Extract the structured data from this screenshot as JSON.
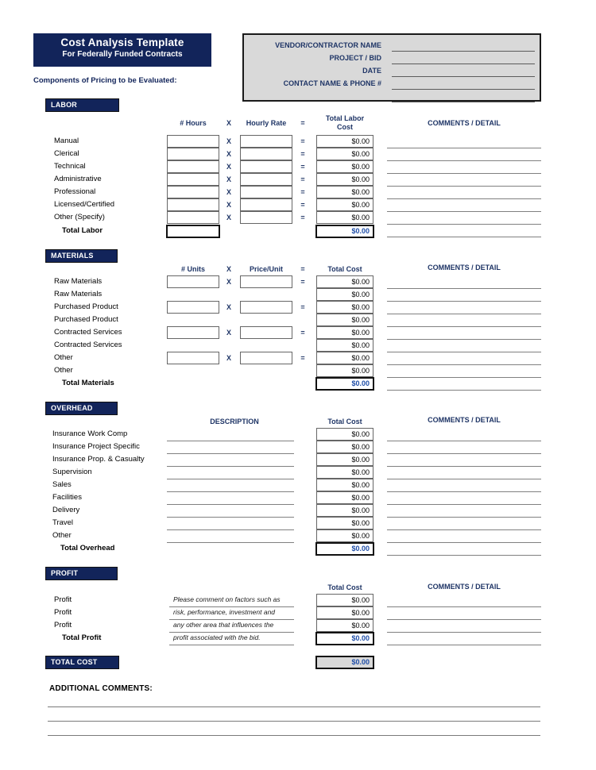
{
  "title": {
    "main": "Cost Analysis Template",
    "sub": "For Federally Funded Contracts",
    "components_label": "Components of Pricing to be Evaluated:"
  },
  "vendor_header": {
    "fields": [
      {
        "label": "VENDOR/CONTRACTOR NAME",
        "value": ""
      },
      {
        "label": "PROJECT / BID",
        "value": ""
      },
      {
        "label": "DATE",
        "value": ""
      },
      {
        "label": "CONTACT NAME & PHONE #",
        "value": ""
      }
    ]
  },
  "operators": {
    "times": "X",
    "equals": "="
  },
  "money_zero": "$0.00",
  "sections": {
    "labor": {
      "chip": "LABOR",
      "columns": {
        "qty": "# Hours",
        "rate": "Hourly Rate",
        "total_line1": "Total Labor",
        "total_line2": "Cost",
        "comments": "COMMENTS / DETAIL"
      },
      "rows": [
        {
          "label": "Manual",
          "qty": "",
          "rate": "",
          "total": "$0.00",
          "comment": ""
        },
        {
          "label": "Clerical",
          "qty": "",
          "rate": "",
          "total": "$0.00",
          "comment": ""
        },
        {
          "label": "Technical",
          "qty": "",
          "rate": "",
          "total": "$0.00",
          "comment": ""
        },
        {
          "label": "Administrative",
          "qty": "",
          "rate": "",
          "total": "$0.00",
          "comment": ""
        },
        {
          "label": "Professional",
          "qty": "",
          "rate": "",
          "total": "$0.00",
          "comment": ""
        },
        {
          "label": "Licensed/Certified",
          "qty": "",
          "rate": "",
          "total": "$0.00",
          "comment": ""
        },
        {
          "label": "Other (Specify)",
          "qty": "",
          "rate": "",
          "total": "$0.00",
          "comment": ""
        }
      ],
      "total_row": {
        "label": "Total Labor",
        "qty": "",
        "total": "$0.00"
      }
    },
    "materials": {
      "chip": "MATERIALS",
      "columns": {
        "qty": "# Units",
        "rate": "Price/Unit",
        "total": "Total Cost",
        "comments": "COMMENTS / DETAIL"
      },
      "rows": [
        {
          "label": "Raw Materials",
          "has_inputs": true,
          "total": "$0.00",
          "comment": ""
        },
        {
          "label": "Raw Materials",
          "has_inputs": false,
          "total": "$0.00",
          "comment": ""
        },
        {
          "label": "Purchased Product",
          "has_inputs": true,
          "total": "$0.00",
          "comment": ""
        },
        {
          "label": "Purchased Product",
          "has_inputs": false,
          "total": "$0.00",
          "comment": ""
        },
        {
          "label": "Contracted Services",
          "has_inputs": true,
          "total": "$0.00",
          "comment": ""
        },
        {
          "label": "Contracted Services",
          "has_inputs": false,
          "total": "$0.00",
          "comment": ""
        },
        {
          "label": "Other",
          "has_inputs": true,
          "total": "$0.00",
          "comment": ""
        },
        {
          "label": "Other",
          "has_inputs": false,
          "total": "$0.00",
          "comment": ""
        }
      ],
      "total_row": {
        "label": "Total Materials",
        "total": "$0.00"
      }
    },
    "overhead": {
      "chip": "OVERHEAD",
      "columns": {
        "description": "DESCRIPTION",
        "total": "Total Cost",
        "comments": "COMMENTS / DETAIL"
      },
      "rows": [
        {
          "label": "Insurance Work Comp",
          "description": "",
          "total": "$0.00",
          "comment": ""
        },
        {
          "label": "Insurance Project Specific",
          "description": "",
          "total": "$0.00",
          "comment": ""
        },
        {
          "label": "Insurance Prop. & Casualty",
          "description": "",
          "total": "$0.00",
          "comment": ""
        },
        {
          "label": "Supervision",
          "description": "",
          "total": "$0.00",
          "comment": ""
        },
        {
          "label": "Sales",
          "description": "",
          "total": "$0.00",
          "comment": ""
        },
        {
          "label": "Facilities",
          "description": "",
          "total": "$0.00",
          "comment": ""
        },
        {
          "label": "Delivery",
          "description": "",
          "total": "$0.00",
          "comment": ""
        },
        {
          "label": "Travel",
          "description": "",
          "total": "$0.00",
          "comment": ""
        },
        {
          "label": "Other",
          "description": "",
          "total": "$0.00",
          "comment": ""
        }
      ],
      "total_row": {
        "label": "Total Overhead",
        "total": "$0.00"
      }
    },
    "profit": {
      "chip": "PROFIT",
      "columns": {
        "total": "Total Cost",
        "comments": "COMMENTS / DETAIL"
      },
      "rows": [
        {
          "label": "Profit",
          "note": "Please comment on factors such as",
          "total": "$0.00",
          "comment": ""
        },
        {
          "label": "Profit",
          "note": "risk, performance, investment and",
          "total": "$0.00",
          "comment": ""
        },
        {
          "label": "Profit",
          "note": "any other area that influences the",
          "total": "$0.00",
          "comment": ""
        }
      ],
      "total_row": {
        "label": "Total Profit",
        "note": "profit associated with the bid.",
        "total": "$0.00"
      }
    },
    "total_cost": {
      "chip": "TOTAL COST",
      "value": "$0.00"
    }
  },
  "additional_comments": {
    "label": "ADDITIONAL COMMENTS:",
    "lines": [
      "",
      "",
      ""
    ]
  },
  "colors": {
    "navy": "#12245a",
    "header_text": "#1f3566",
    "money_blue": "#1f4ea8",
    "gray_fill": "#d9d9d9"
  }
}
